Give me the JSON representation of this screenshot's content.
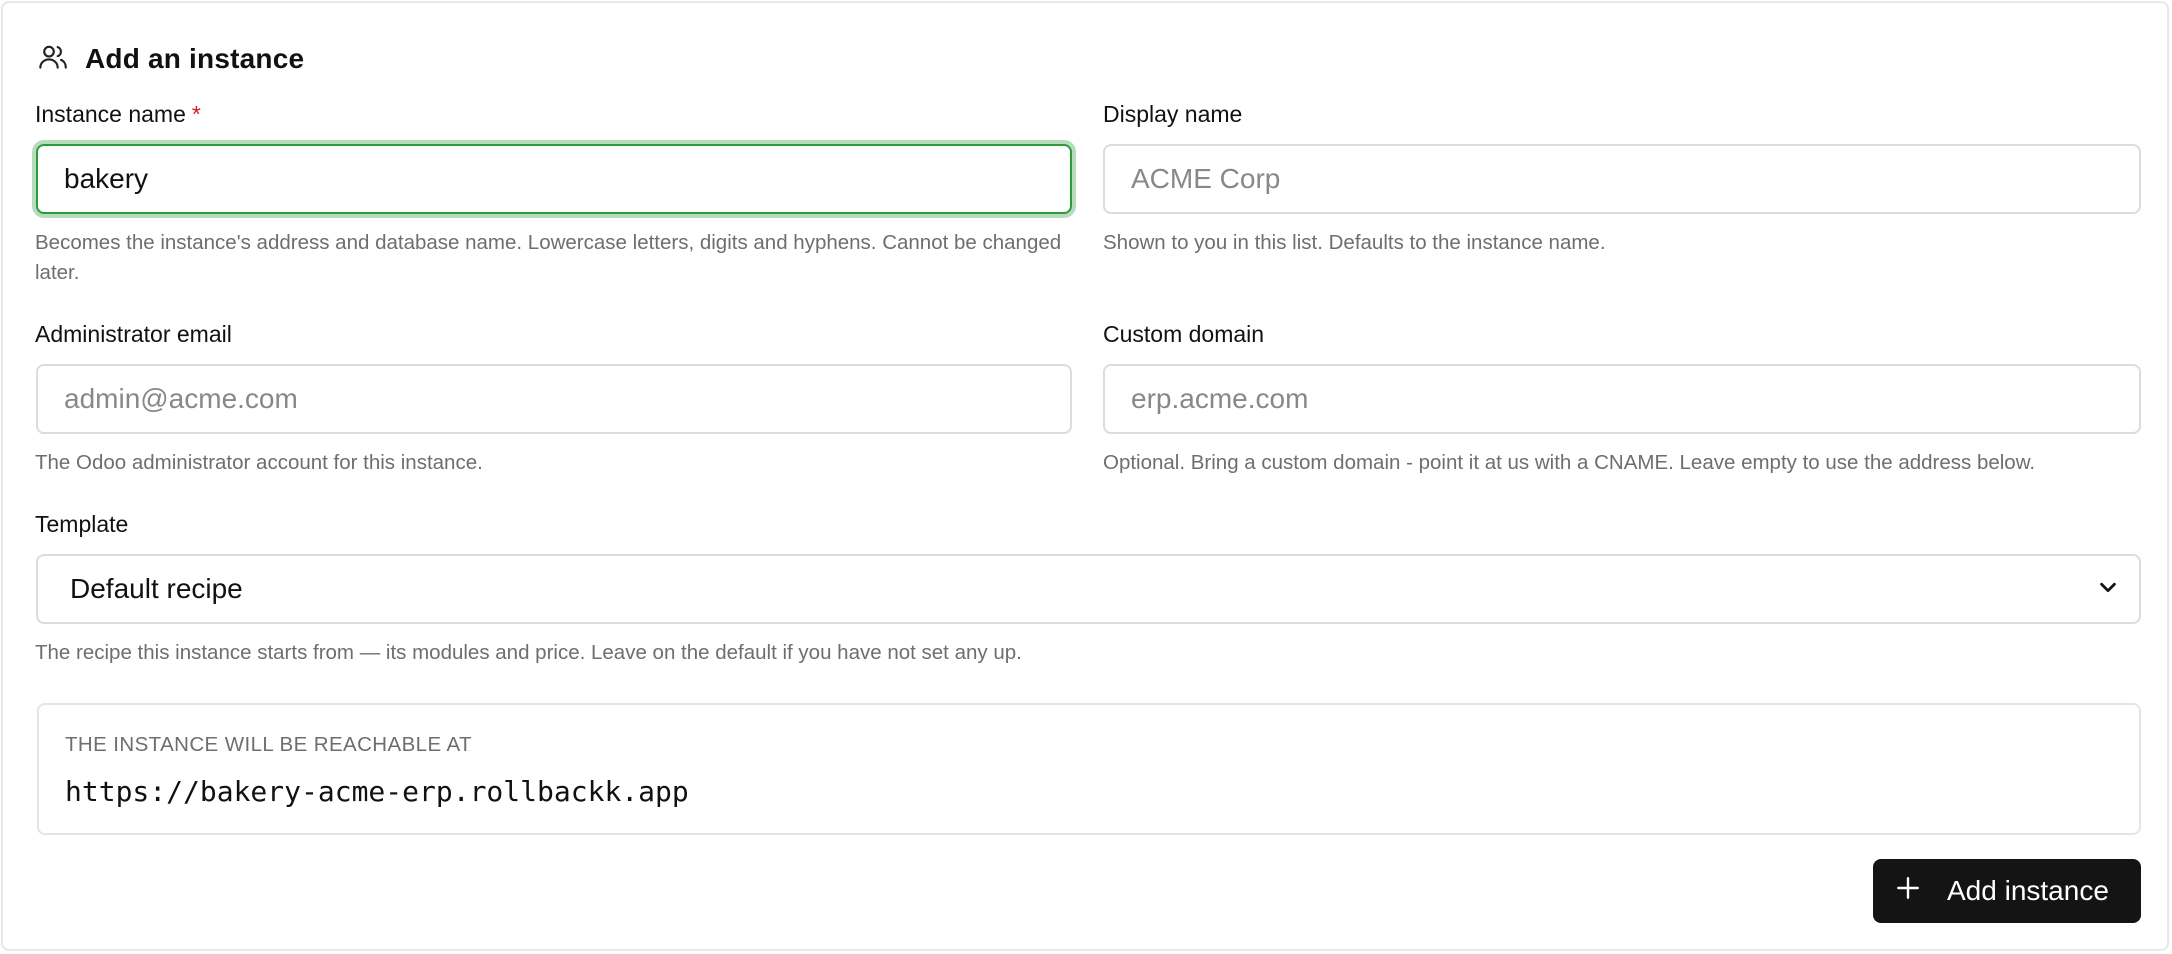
{
  "form": {
    "title": "Add an instance",
    "title_icon": "users-icon"
  },
  "instance_name": {
    "label": "Instance name",
    "required_mark": "*",
    "value": "bakery",
    "help": "Becomes the instance's address and database name. Lowercase letters, digits and hyphens. Cannot be changed later."
  },
  "display_name": {
    "label": "Display name",
    "value": "",
    "placeholder": "ACME Corp",
    "help": "Shown to you in this list. Defaults to the instance name."
  },
  "admin_email": {
    "label": "Administrator email",
    "value": "",
    "placeholder": "admin@acme.com",
    "help": "The Odoo administrator account for this instance."
  },
  "custom_domain": {
    "label": "Custom domain",
    "value": "",
    "placeholder": "erp.acme.com",
    "help": "Optional. Bring a custom domain - point it at us with a CNAME. Leave empty to use the address below."
  },
  "template": {
    "label": "Template",
    "selected": "Default recipe",
    "help": "The recipe this instance starts from — its modules and price. Leave on the default if you have not set any up."
  },
  "reachable": {
    "caption": "THE INSTANCE WILL BE REACHABLE AT",
    "url": "https://bakery-acme-erp.rollbackk.app"
  },
  "submit": {
    "label": "Add instance",
    "icon": "plus-icon"
  },
  "colors": {
    "focus_ring": "#2f9a3c",
    "required": "#d61a1a",
    "button_bg": "#141414"
  }
}
